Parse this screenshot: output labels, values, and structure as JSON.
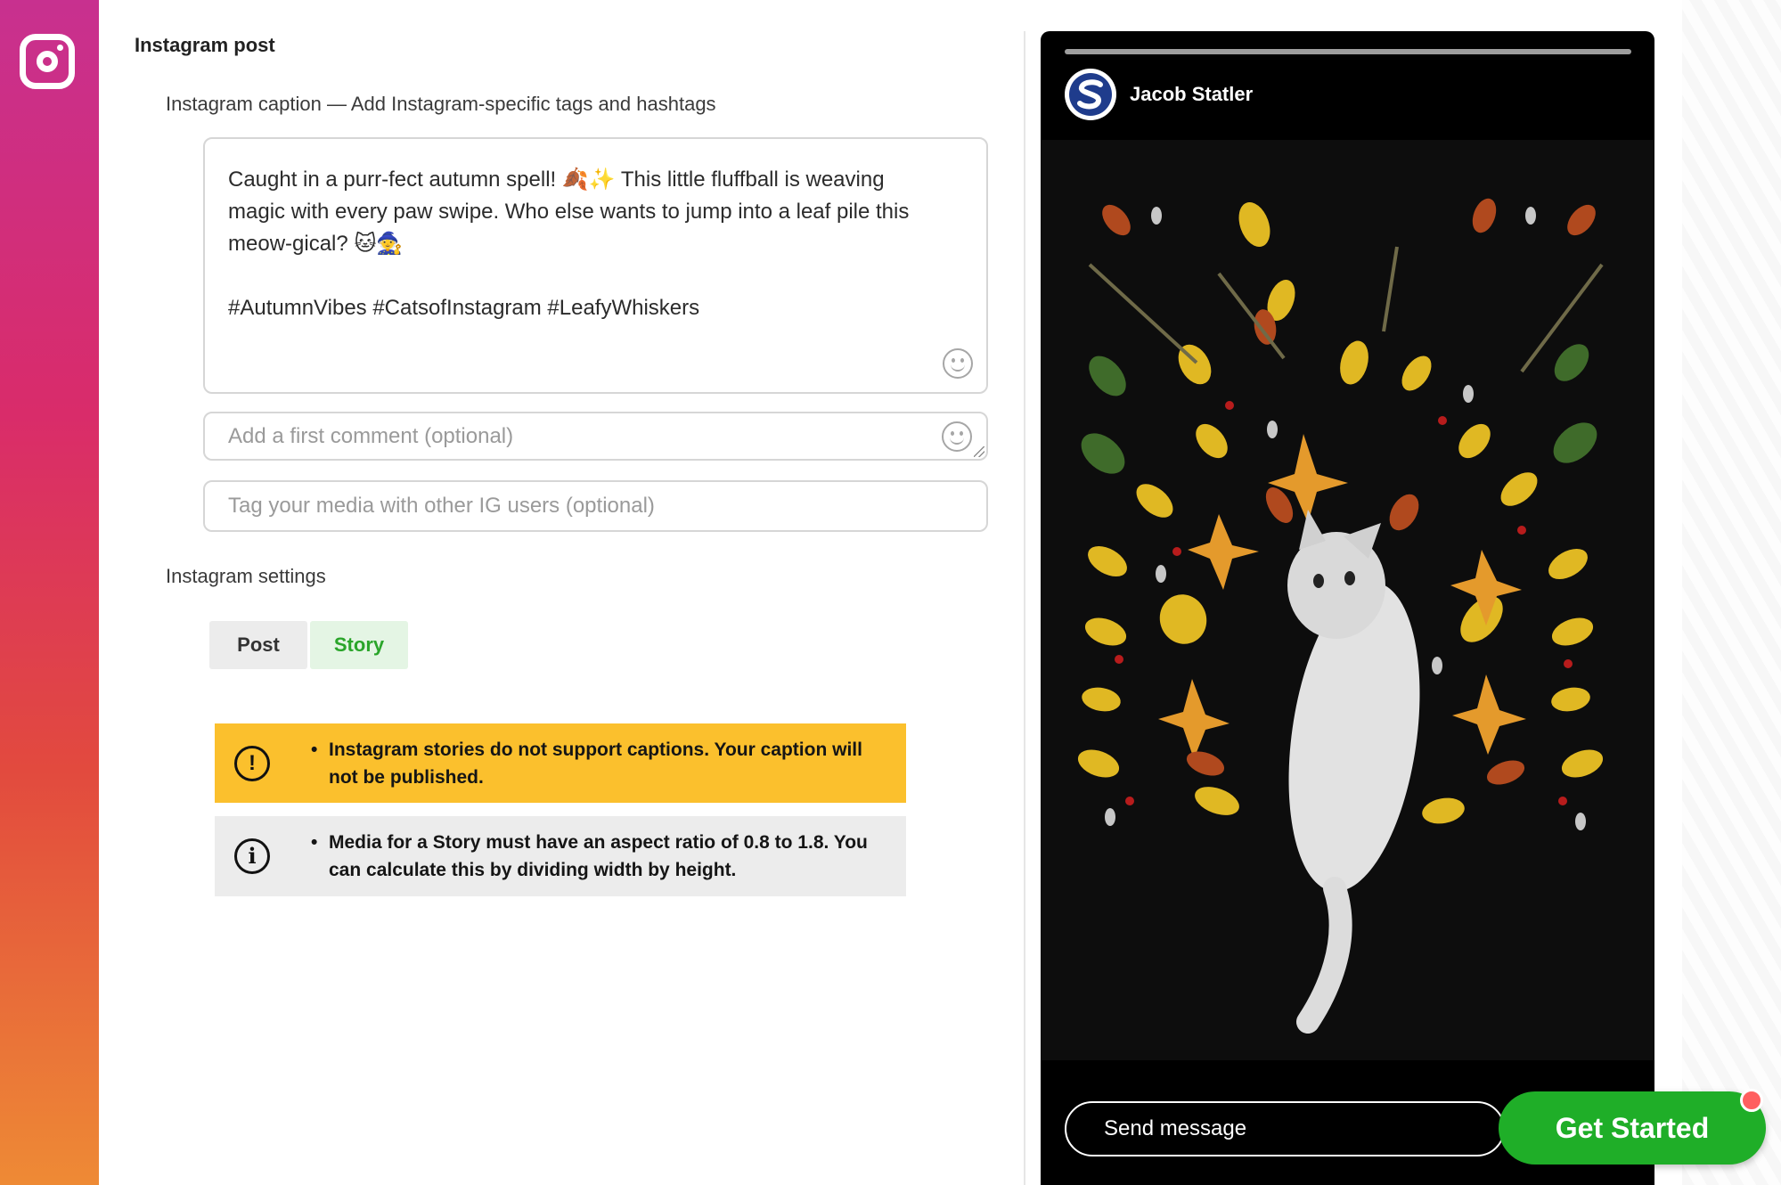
{
  "sidebar": {
    "icon": "instagram-icon"
  },
  "post": {
    "title": "Instagram post",
    "caption_label": "Instagram caption — Add Instagram-specific tags and hashtags",
    "caption_value": "Caught in a purr-fect autumn spell! 🍂✨ This little fluffball is weaving magic with every paw swipe. Who else wants to jump into a leaf pile this meow-gical? 🐱🧙\n\n#AutumnVibes #CatsofInstagram #LeafyWhiskers",
    "first_comment_placeholder": "Add a first comment (optional)",
    "tag_placeholder": "Tag your media with other IG users (optional)"
  },
  "settings": {
    "label": "Instagram settings",
    "options": [
      "Post",
      "Story"
    ],
    "selected": "Story"
  },
  "alerts": [
    {
      "type": "warning",
      "icon": "exclamation-circle-icon",
      "bullet": "•",
      "text": "Instagram stories do not support captions. Your caption will not be published."
    },
    {
      "type": "info",
      "icon": "info-circle-icon",
      "bullet": "•",
      "text": "Media for a Story must have an aspect ratio of 0.8 to 1.8. You can calculate this by dividing width by height."
    }
  ],
  "preview": {
    "username": "Jacob Statler",
    "avatar_letter": "S",
    "send_placeholder": "Send message",
    "image_alt": "cat-on-autumn-leaves-image"
  },
  "cta": {
    "label": "Get Started"
  },
  "colors": {
    "warning": "#fbc02d",
    "info": "#ececec",
    "story_active_text": "#2aa52a",
    "cta": "#1fae28",
    "notification_dot": "#ff5f5f"
  }
}
